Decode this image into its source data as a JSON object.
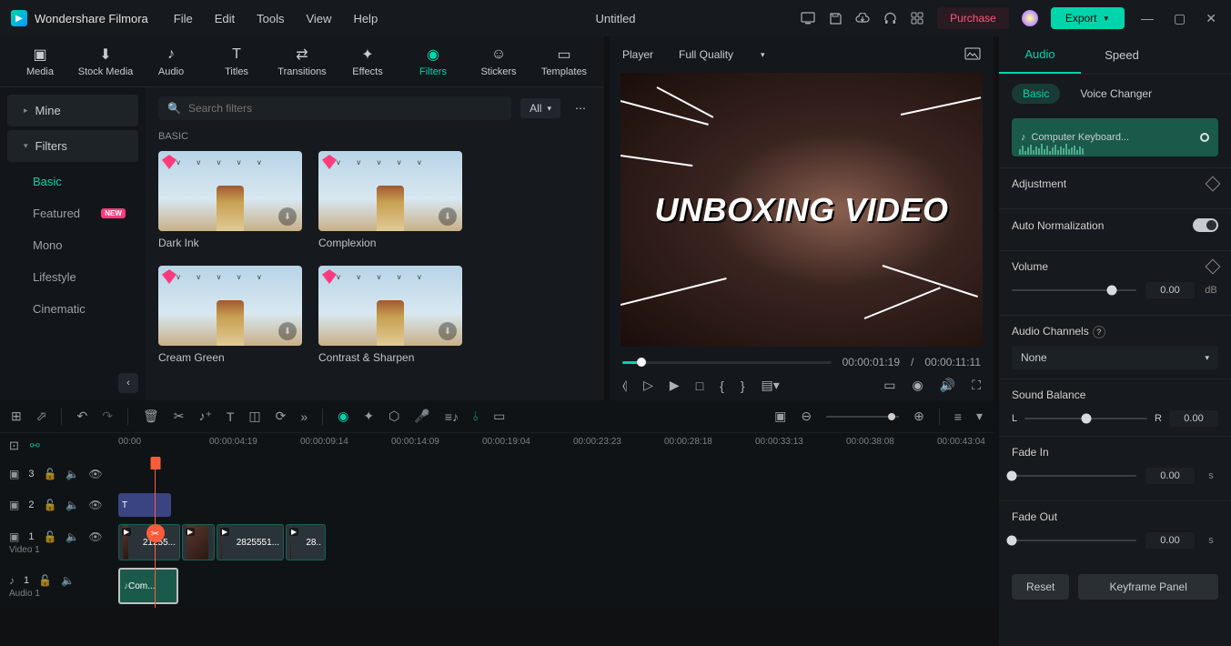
{
  "app": {
    "name": "Wondershare Filmora",
    "title": "Untitled"
  },
  "menu": [
    "File",
    "Edit",
    "Tools",
    "View",
    "Help"
  ],
  "header": {
    "purchase": "Purchase",
    "export": "Export"
  },
  "tabs": [
    {
      "label": "Media",
      "active": false
    },
    {
      "label": "Stock Media",
      "active": false
    },
    {
      "label": "Audio",
      "active": false
    },
    {
      "label": "Titles",
      "active": false
    },
    {
      "label": "Transitions",
      "active": false
    },
    {
      "label": "Effects",
      "active": false
    },
    {
      "label": "Filters",
      "active": true
    },
    {
      "label": "Stickers",
      "active": false
    },
    {
      "label": "Templates",
      "active": false
    }
  ],
  "sidebar": {
    "mine": "Mine",
    "filters": "Filters",
    "cats": [
      {
        "label": "Basic",
        "active": true
      },
      {
        "label": "Featured",
        "new": true
      },
      {
        "label": "Mono"
      },
      {
        "label": "Lifestyle"
      },
      {
        "label": "Cinematic"
      }
    ]
  },
  "search": {
    "placeholder": "Search filters",
    "dd": "All"
  },
  "section_label": "BASIC",
  "filters_grid": [
    {
      "label": "Dark Ink"
    },
    {
      "label": "Complexion"
    },
    {
      "label": "Cream Green"
    },
    {
      "label": "Contrast & Sharpen"
    }
  ],
  "player": {
    "label": "Player",
    "quality": "Full Quality",
    "overlay_text": "UNBOXING VIDEO",
    "current": "00:00:01:19",
    "sep": "/",
    "total": "00:00:11:11"
  },
  "right": {
    "tabs": [
      "Audio",
      "Speed"
    ],
    "subtabs": [
      "Basic",
      "Voice Changer"
    ],
    "clip_name": "Computer Keyboard...",
    "adjustment": "Adjustment",
    "auto_norm": "Auto Normalization",
    "volume": "Volume",
    "vol_val": "0.00",
    "vol_unit": "dB",
    "channels": "Audio Channels",
    "channels_val": "None",
    "balance": "Sound Balance",
    "bal_left": "L",
    "bal_right": "R",
    "bal_val": "0.00",
    "fade_in": "Fade In",
    "fade_in_val": "0.00",
    "fade_in_unit": "s",
    "fade_out": "Fade Out",
    "fade_out_val": "0.00",
    "fade_out_unit": "s",
    "reset": "Reset",
    "keyframe": "Keyframe Panel"
  },
  "timeline": {
    "ruler": [
      "00:00",
      "00:00:04:19",
      "00:00:09:14",
      "00:00:14:09",
      "00:00:19:04",
      "00:00:23:23",
      "00:00:28:18",
      "00:00:33:13",
      "00:00:38:08",
      "00:00:43:04"
    ],
    "tracks": {
      "v3": "3",
      "v2": "2",
      "v1": "1",
      "v1_label": "Video 1",
      "a1": "1",
      "a1_label": "Audio 1"
    },
    "clips": {
      "v1a": "21255...",
      "v1b": "2825551...",
      "v1c": "28..",
      "audio": "Com..."
    }
  }
}
